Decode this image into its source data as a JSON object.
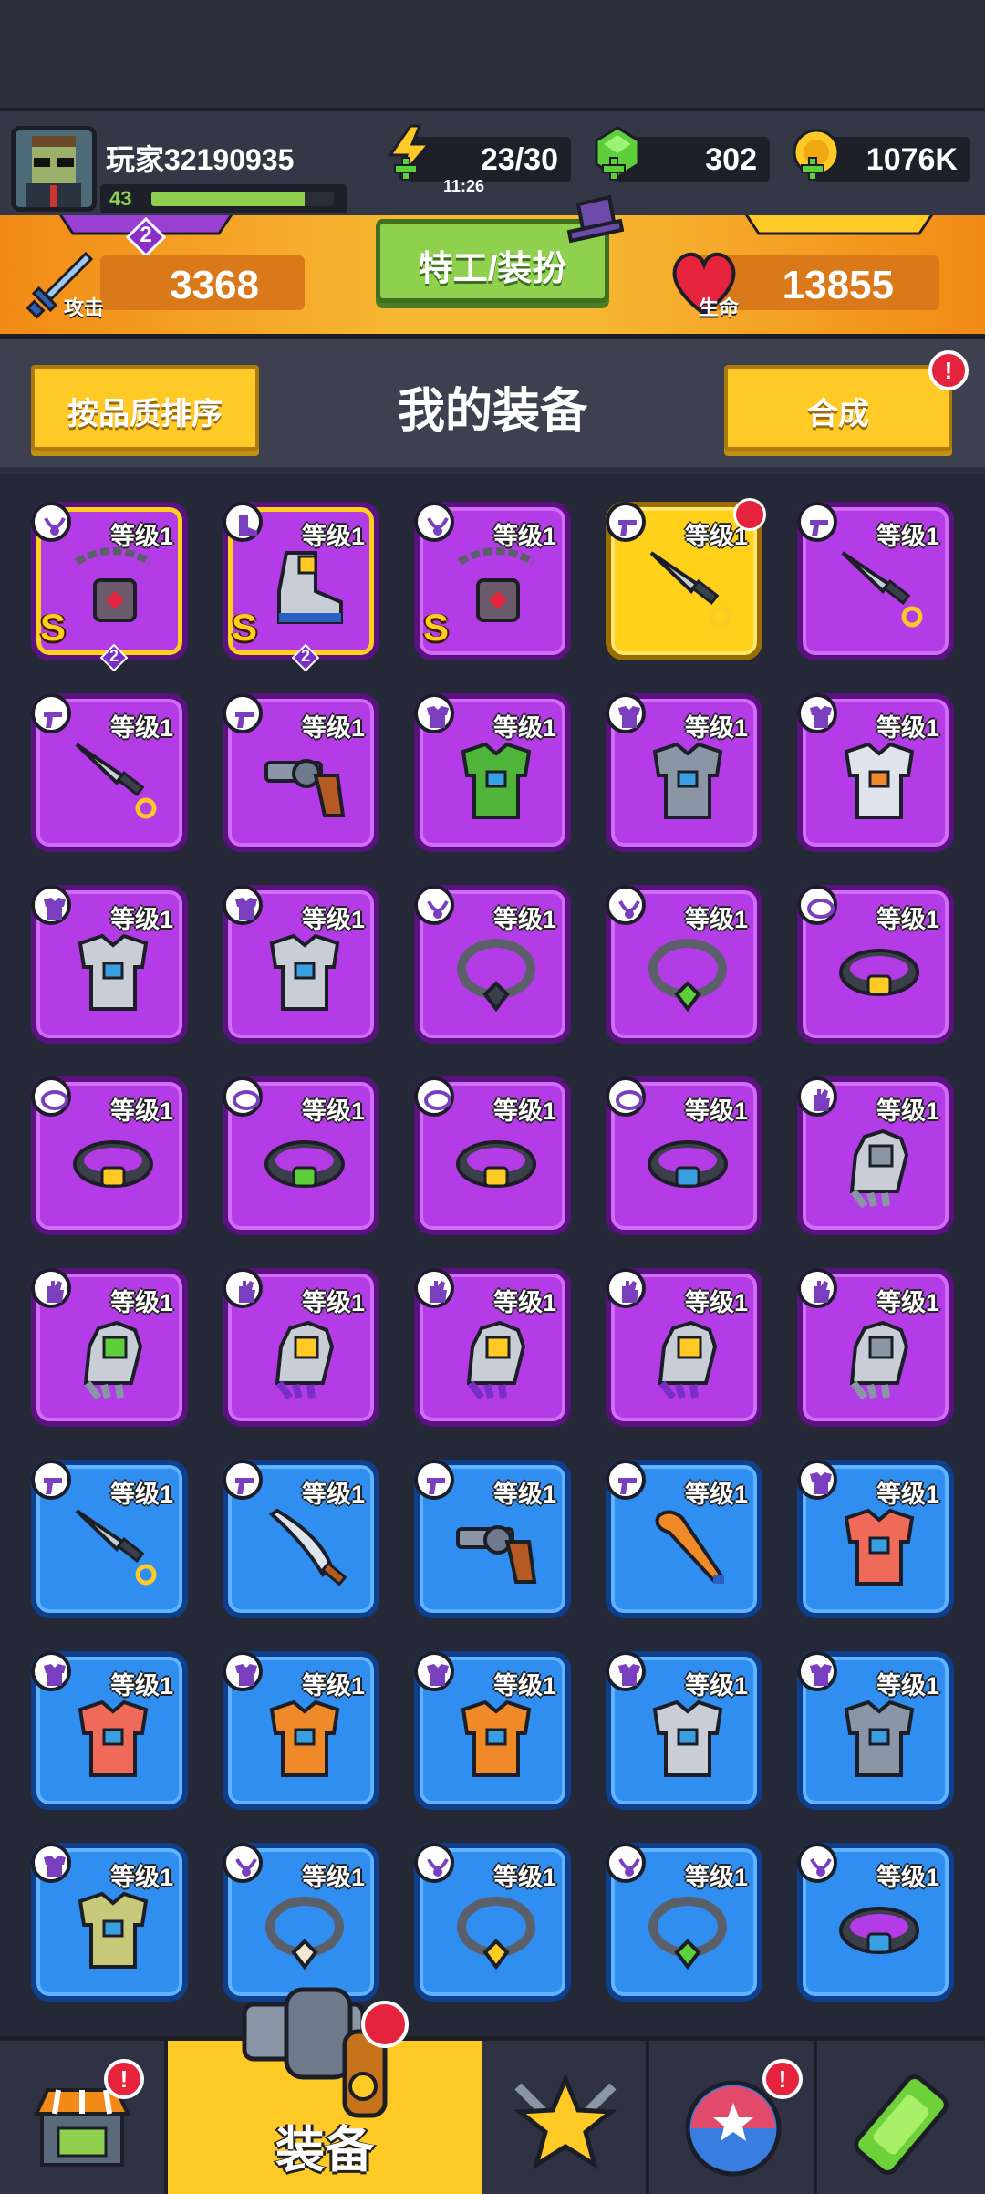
{
  "player": {
    "name": "玩家32190935",
    "level": "43",
    "xp_fraction": 0.84
  },
  "resources": {
    "energy": "23/30",
    "energy_timer": "11:26",
    "gems": "302",
    "coins": "1076K"
  },
  "stats": {
    "attack_label": "攻击",
    "attack": "3368",
    "hp_label": "生命",
    "hp": "13855",
    "agent_button": "特工/装扮",
    "rank_badge": "2"
  },
  "header": {
    "sort_button": "按品质排序",
    "title": "我的装备",
    "merge_button": "合成",
    "alert": "!"
  },
  "equipment": {
    "level_text": "等级1",
    "grade_text": "S",
    "items": [
      {
        "tier": "purple",
        "type": "necklace-icon",
        "item": "chain-lock-necklace",
        "grade": true,
        "stars": "2"
      },
      {
        "tier": "purple",
        "type": "boot-icon",
        "item": "armored-boot",
        "grade": true,
        "stars": "2"
      },
      {
        "tier": "purple",
        "type": "necklace-icon",
        "item": "chain-lock-necklace",
        "grade": true
      },
      {
        "tier": "gold",
        "type": "weapon-icon",
        "item": "kunai",
        "badge": true
      },
      {
        "tier": "purple",
        "type": "weapon-icon",
        "item": "kunai"
      },
      {
        "tier": "purple",
        "type": "weapon-icon",
        "item": "kunai"
      },
      {
        "tier": "purple",
        "type": "weapon-icon",
        "item": "revolver"
      },
      {
        "tier": "purple",
        "type": "armor-icon",
        "item": "leaf-armor"
      },
      {
        "tier": "purple",
        "type": "armor-icon",
        "item": "stone-armor"
      },
      {
        "tier": "purple",
        "type": "armor-icon",
        "item": "robot-armor"
      },
      {
        "tier": "purple",
        "type": "armor-icon",
        "item": "steel-vest"
      },
      {
        "tier": "purple",
        "type": "armor-icon",
        "item": "steel-vest"
      },
      {
        "tier": "purple",
        "type": "necklace-icon",
        "item": "spiked-collar"
      },
      {
        "tier": "purple",
        "type": "necklace-icon",
        "item": "emerald-ring-necklace"
      },
      {
        "tier": "purple",
        "type": "belt-icon",
        "item": "rope-belt"
      },
      {
        "tier": "purple",
        "type": "belt-icon",
        "item": "star-belt"
      },
      {
        "tier": "purple",
        "type": "belt-icon",
        "item": "gem-belt"
      },
      {
        "tier": "purple",
        "type": "belt-icon",
        "item": "gold-belt"
      },
      {
        "tier": "purple",
        "type": "belt-icon",
        "item": "shield-belt"
      },
      {
        "tier": "purple",
        "type": "glove-icon",
        "item": "steel-gauntlet"
      },
      {
        "tier": "purple",
        "type": "glove-icon",
        "item": "green-gauntlet"
      },
      {
        "tier": "purple",
        "type": "glove-icon",
        "item": "purple-gauntlet"
      },
      {
        "tier": "purple",
        "type": "glove-icon",
        "item": "purple-gauntlet"
      },
      {
        "tier": "purple",
        "type": "glove-icon",
        "item": "purple-gauntlet"
      },
      {
        "tier": "purple",
        "type": "glove-icon",
        "item": "steel-gauntlet"
      },
      {
        "tier": "blue",
        "type": "weapon-icon",
        "item": "kunai"
      },
      {
        "tier": "blue",
        "type": "weapon-icon",
        "item": "machete"
      },
      {
        "tier": "blue",
        "type": "weapon-icon",
        "item": "revolver"
      },
      {
        "tier": "blue",
        "type": "weapon-icon",
        "item": "baseball-bat"
      },
      {
        "tier": "blue",
        "type": "armor-icon",
        "item": "red-vest"
      },
      {
        "tier": "blue",
        "type": "armor-icon",
        "item": "red-vest"
      },
      {
        "tier": "blue",
        "type": "armor-icon",
        "item": "orange-jacket"
      },
      {
        "tier": "blue",
        "type": "armor-icon",
        "item": "orange-jacket"
      },
      {
        "tier": "blue",
        "type": "armor-icon",
        "item": "steel-vest"
      },
      {
        "tier": "blue",
        "type": "armor-icon",
        "item": "stone-armor"
      },
      {
        "tier": "blue",
        "type": "armor-icon",
        "item": "camo-shirt"
      },
      {
        "tier": "blue",
        "type": "necklace-icon",
        "item": "bone-necklace"
      },
      {
        "tier": "blue",
        "type": "necklace-icon",
        "item": "lightning-necklace"
      },
      {
        "tier": "blue",
        "type": "necklace-icon",
        "item": "emerald-necklace"
      },
      {
        "tier": "blue",
        "type": "necklace-icon",
        "item": "blue-belt"
      }
    ]
  },
  "nav": {
    "active_label": "装备",
    "tabs": [
      "shop-icon",
      "equipment-icon",
      "talent-icon",
      "gacha-icon",
      "dna-icon"
    ]
  },
  "colors": {
    "purple": "#b43ce6",
    "blue": "#2f8ef0",
    "gold": "#ffd11a",
    "accent": "#ffc926",
    "green": "#8fd14f",
    "alert": "#e6233c"
  }
}
